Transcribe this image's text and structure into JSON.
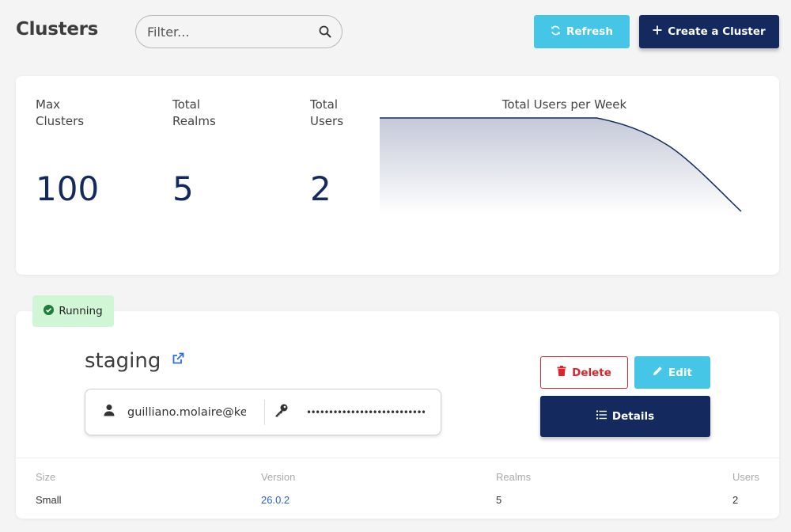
{
  "header": {
    "title": "Clusters",
    "filter_placeholder": "Filter...",
    "refresh_label": "Refresh",
    "create_label": "Create a Cluster"
  },
  "stats": {
    "max_clusters_label": "Max Clusters",
    "max_clusters_value": "100",
    "total_realms_label": "Total Realms",
    "total_realms_value": "5",
    "total_users_label": "Total Users",
    "total_users_value": "2"
  },
  "chart_data": {
    "type": "area",
    "title": "Total Users per Week",
    "x": [
      1,
      2,
      3,
      4,
      5,
      6
    ],
    "values": [
      2,
      2,
      2,
      2,
      1.4,
      0
    ],
    "ylim": [
      0,
      2
    ],
    "grid": false,
    "colors": {
      "line": "#142a5e",
      "fill_top": "#c5c9d8",
      "fill_bottom": "#ffffff"
    }
  },
  "cluster": {
    "status": "Running",
    "name": "staging",
    "username": "guilliano.molaire@keycloak.org",
    "password_masked": "•••••••••••••••••••••••••••••••",
    "delete_label": "Delete",
    "edit_label": "Edit",
    "details_label": "Details",
    "info": {
      "size_label": "Size",
      "size_value": "Small",
      "version_label": "Version",
      "version_value": "26.0.2",
      "realms_label": "Realms",
      "realms_value": "5",
      "users_label": "Users",
      "users_value": "2"
    }
  },
  "icons": {
    "search": "search-icon",
    "refresh": "refresh-icon",
    "plus": "plus-icon",
    "check": "check-circle-icon",
    "external": "external-link-icon",
    "user": "user-icon",
    "key": "key-icon",
    "trash": "trash-icon",
    "pencil": "pencil-icon",
    "list": "list-icon"
  }
}
